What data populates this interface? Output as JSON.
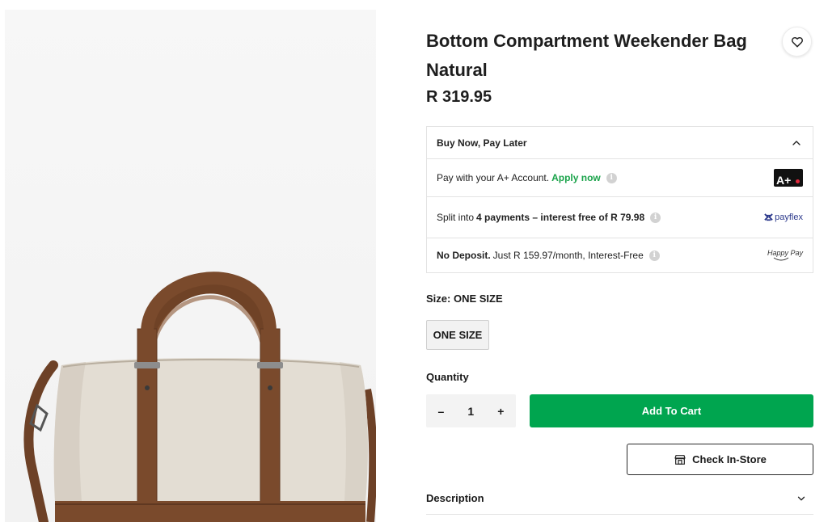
{
  "product": {
    "title": "Bottom Compartment Weekender Bag Natural",
    "price": "R 319.95"
  },
  "bnpl": {
    "heading": "Buy Now, Pay Later",
    "aplus": {
      "text": "Pay with your A+ Account.",
      "link": "Apply now",
      "logo_text": "A+"
    },
    "payflex": {
      "prefix": "Split into",
      "bold": "4 payments – interest free of R 79.98",
      "brand": "payflex"
    },
    "happypay": {
      "bold": "No Deposit.",
      "text": "Just R 159.97/month, Interest-Free",
      "brand": "Happy Pay"
    }
  },
  "size": {
    "label": "Size: ONE SIZE",
    "option": "ONE SIZE"
  },
  "quantity": {
    "label": "Quantity",
    "minus": "–",
    "value": "1",
    "plus": "+"
  },
  "actions": {
    "add_to_cart": "Add To Cart",
    "check_in_store": "Check In-Store"
  },
  "description": {
    "label": "Description"
  },
  "colors": {
    "accent_green": "#00a54f",
    "link_green": "#1aa34a",
    "bag_body": "#e3ddd3",
    "bag_leather": "#7a4a2c"
  },
  "icons": [
    "heart-icon",
    "chevron-up-icon",
    "info-icon",
    "store-icon",
    "chevron-down-icon"
  ]
}
